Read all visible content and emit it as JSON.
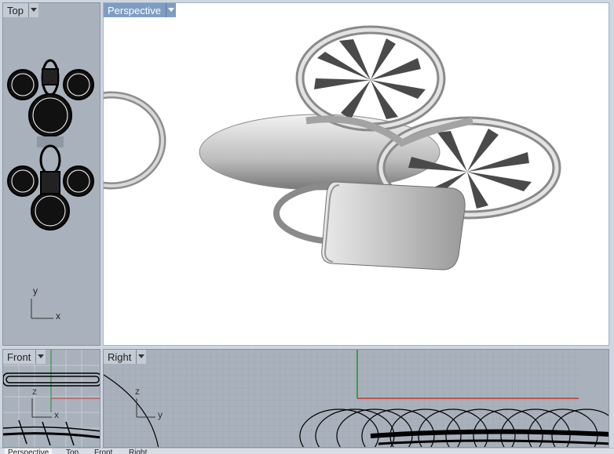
{
  "viewports": {
    "top": {
      "title": "Top",
      "axis_x": "x",
      "axis_y": "y"
    },
    "perspective": {
      "title": "Perspective"
    },
    "front": {
      "title": "Front",
      "axis_x": "x",
      "axis_z": "z"
    },
    "right": {
      "title": "Right",
      "axis_y": "y",
      "axis_z": "z"
    }
  },
  "bottom_tabs": [
    "Perspective",
    "Top",
    "Front",
    "Right"
  ],
  "colors": {
    "active_tab": "#7f9dc2",
    "grid_x_axis": "#c0392b",
    "grid_y_axis": "#1f8f2a",
    "viewport_bg": "#a9b1bc"
  }
}
